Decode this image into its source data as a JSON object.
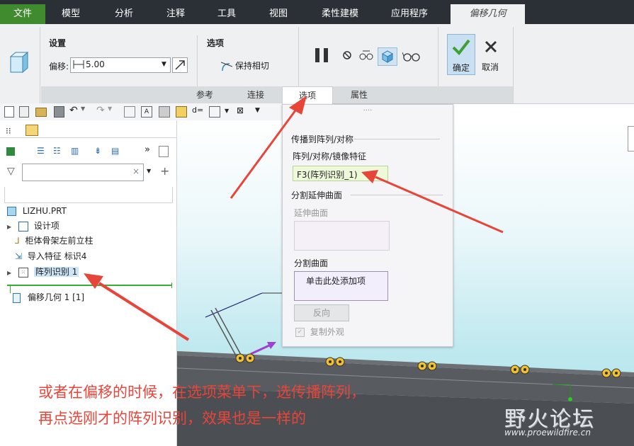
{
  "menu": {
    "tabs": [
      "文件",
      "模型",
      "分析",
      "注释",
      "工具",
      "视图",
      "柔性建模",
      "应用程序"
    ],
    "active_tab": "偏移几何"
  },
  "ribbon": {
    "settings_title": "设置",
    "offset_label": "偏移:",
    "offset_value": "5.00",
    "options_title": "选项",
    "keep_tangent": "保持相切",
    "ok_label": "确定",
    "cancel_label": "取消",
    "dash_tabs": [
      "参考",
      "连接",
      "选项",
      "属性"
    ]
  },
  "left_panel": {
    "root": "LIZHU.PRT",
    "items": [
      "设计项",
      "柜体骨架左前立柱",
      "导入特征 标识4",
      "阵列识别 1",
      "偏移几何 1 [1]"
    ]
  },
  "popup": {
    "handle": "....",
    "section1": "传播到阵列/对称",
    "sub1": "阵列/对称/镜像特征",
    "pattern_item": "F3(阵列识别_1)",
    "section2": "分割延伸曲面",
    "extend_label": "延伸曲面",
    "split_label": "分割曲面",
    "split_placeholder": "单击此处添加项",
    "flip_button": "反向",
    "copy_appearance": "复制外观"
  },
  "annotation": {
    "line1": "或者在偏移的时候，在选项菜单下，选传播阵列，",
    "line2": "再点选刚才的阵列识别，效果也是一样的"
  },
  "watermark": {
    "brand": "野火论坛",
    "url": "www.proewildfire.cn"
  },
  "colors": {
    "accent_green": "#3f8b2e",
    "annotation_red": "#e8453a",
    "selection_blue": "#cce4f7"
  }
}
